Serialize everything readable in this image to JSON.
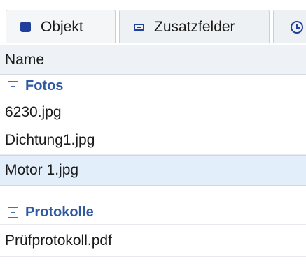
{
  "tabs": [
    {
      "label": "Objekt",
      "icon": "square-icon"
    },
    {
      "label": "Zusatzfelder",
      "icon": "card-icon"
    },
    {
      "label": "",
      "icon": "clock-icon"
    }
  ],
  "table": {
    "column_header": "Name",
    "groups": [
      {
        "label": "Fotos",
        "items": [
          "6230.jpg",
          "Dichtung1.jpg",
          "Motor 1.jpg"
        ]
      },
      {
        "label": "Protokolle",
        "items": [
          "Prüfprotokoll.pdf"
        ]
      }
    ],
    "selected_item": "Motor 1.jpg"
  },
  "colors": {
    "accent": "#1f3f9a",
    "group_text": "#2f5aa3",
    "selected_row": "#e3eefb",
    "header_bg": "#eef1f5"
  }
}
